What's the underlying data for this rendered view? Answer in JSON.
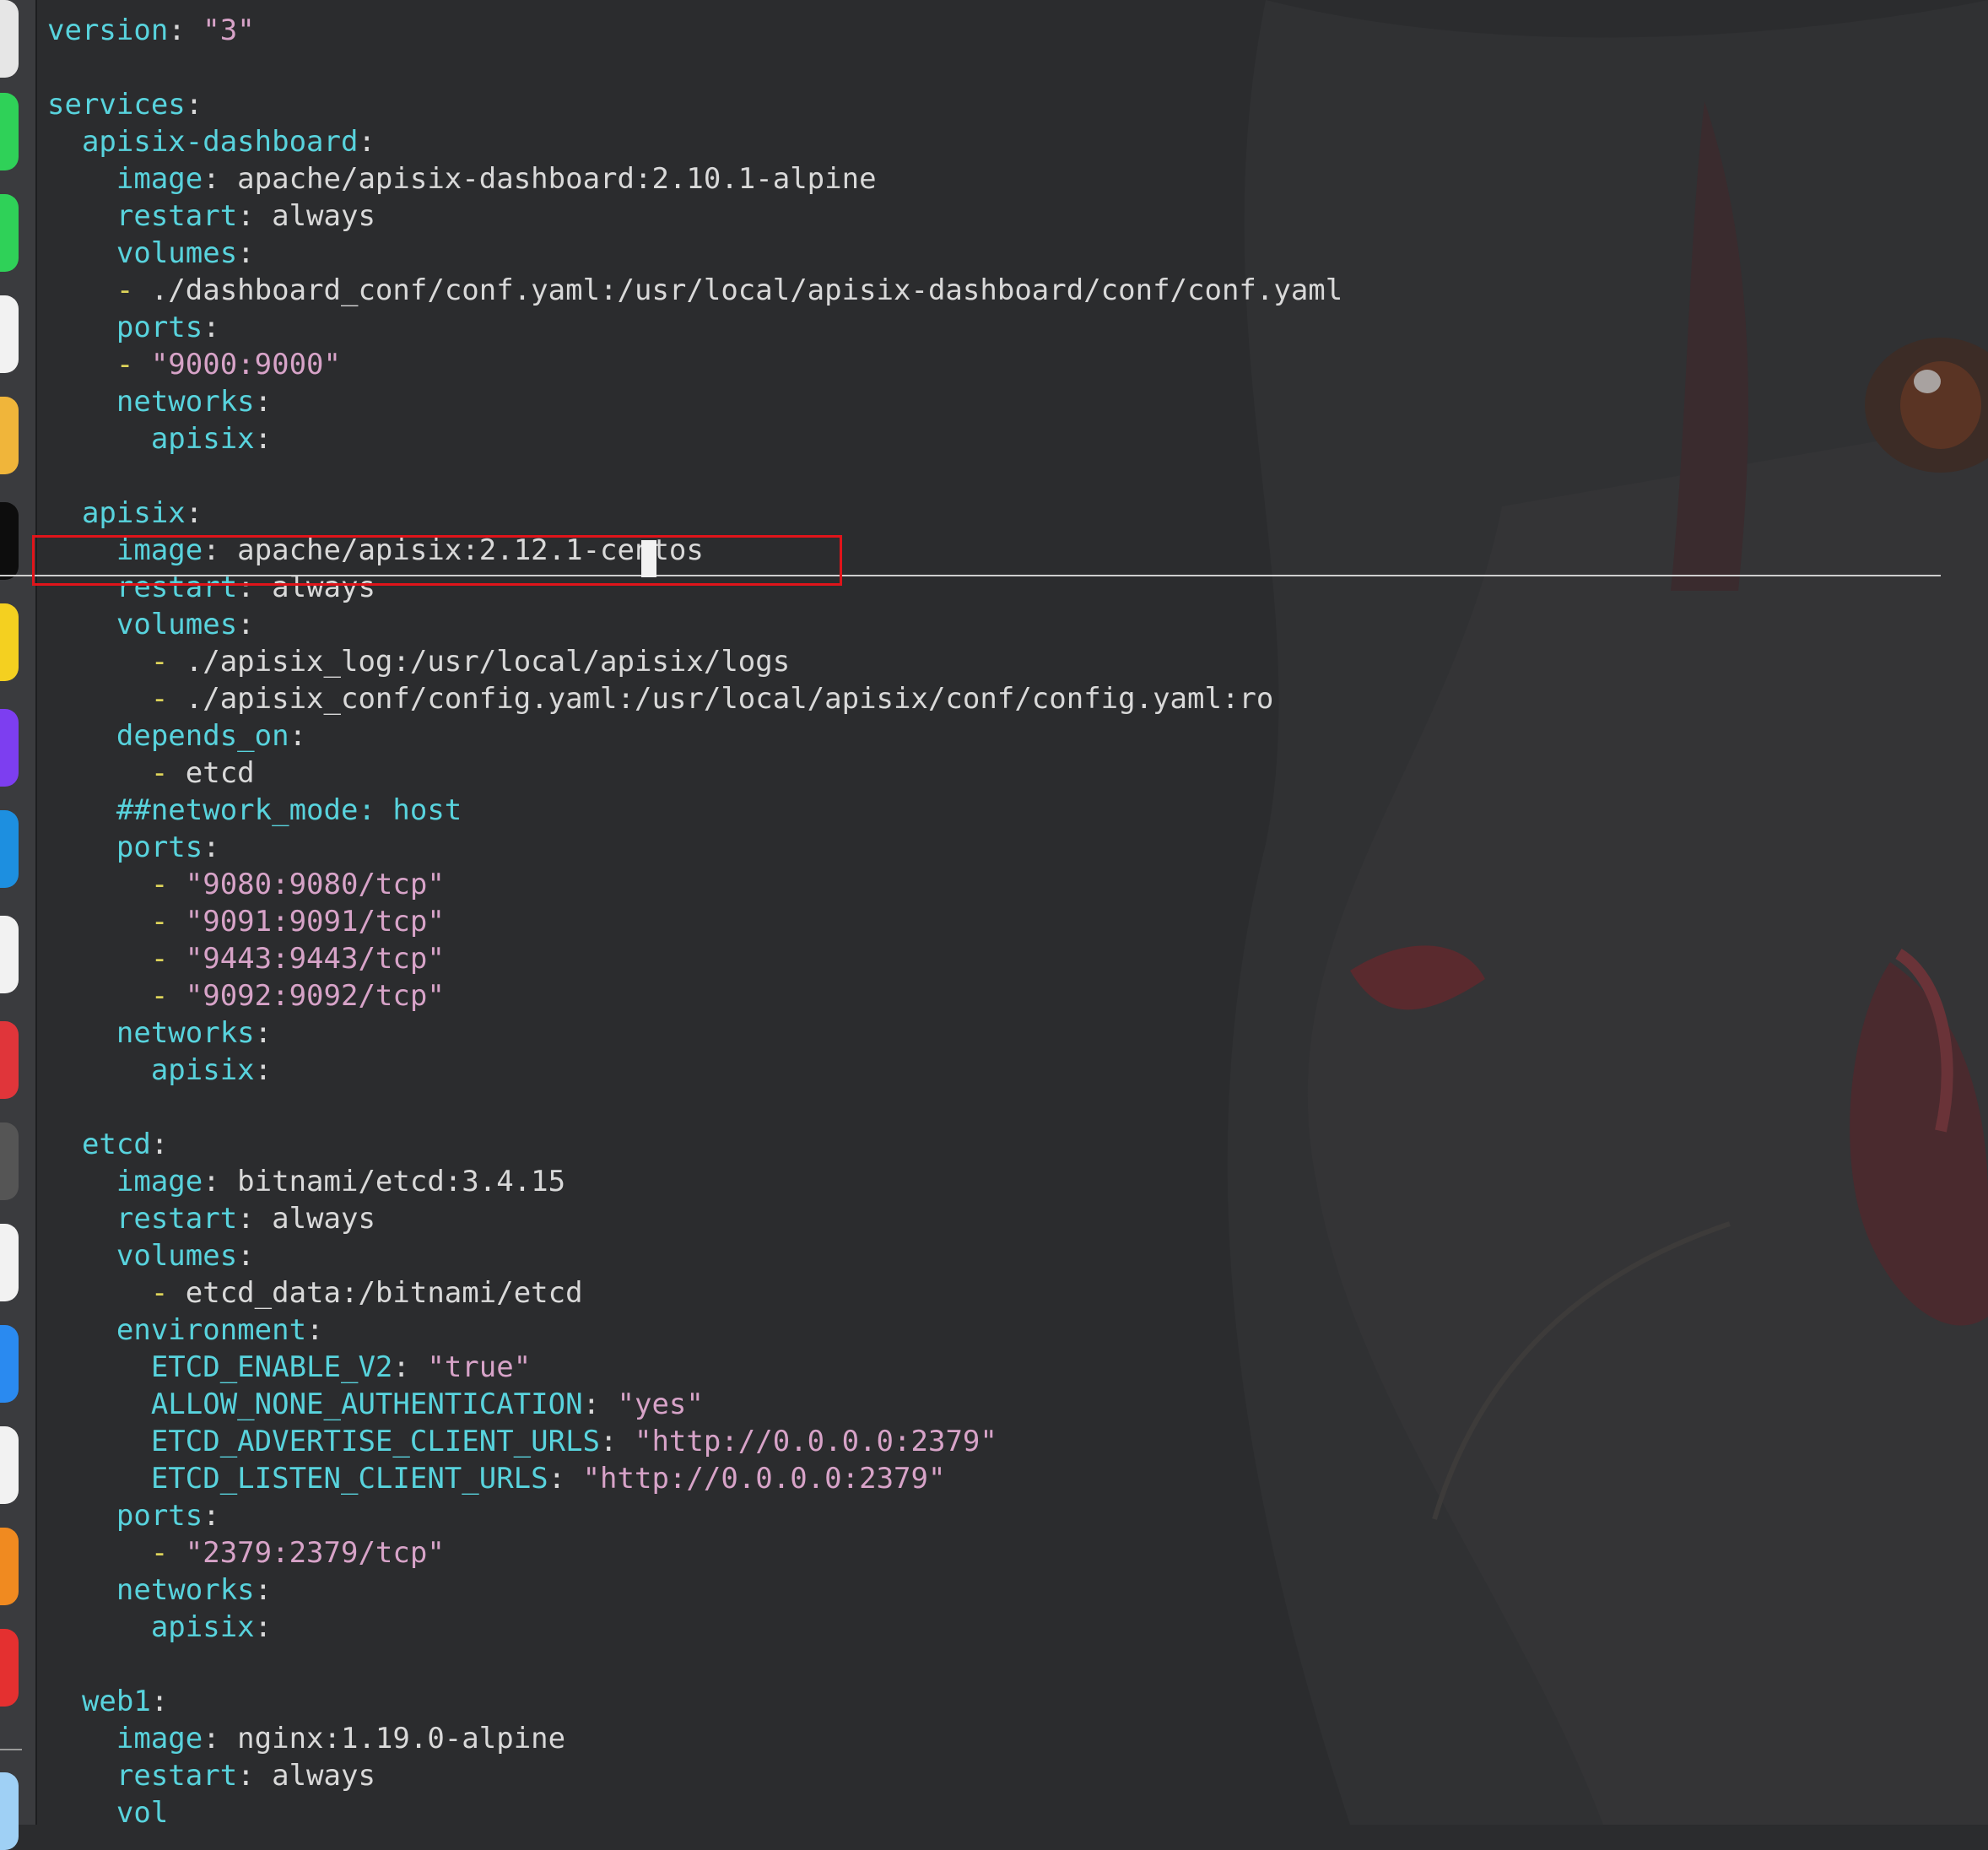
{
  "editor": {
    "lines": [
      [
        {
          "t": "version",
          "c": "k"
        },
        {
          "t": ": ",
          "c": "p"
        },
        {
          "t": "\"3\"",
          "c": "s"
        }
      ],
      [],
      [
        {
          "t": "services",
          "c": "k"
        },
        {
          "t": ":",
          "c": "p"
        }
      ],
      [
        {
          "t": "  apisix-dashboard",
          "c": "k"
        },
        {
          "t": ":",
          "c": "p"
        }
      ],
      [
        {
          "t": "    image",
          "c": "k"
        },
        {
          "t": ": apache/apisix-dashboard:2.10.1-alpine",
          "c": "p"
        }
      ],
      [
        {
          "t": "    restart",
          "c": "k"
        },
        {
          "t": ": always",
          "c": "p"
        }
      ],
      [
        {
          "t": "    volumes",
          "c": "k"
        },
        {
          "t": ":",
          "c": "p"
        }
      ],
      [
        {
          "t": "    - ",
          "c": "d"
        },
        {
          "t": "./dashboard_conf/conf.yaml:/usr/local/apisix-dashboard/conf/conf.yaml",
          "c": "p"
        }
      ],
      [
        {
          "t": "    ports",
          "c": "k"
        },
        {
          "t": ":",
          "c": "p"
        }
      ],
      [
        {
          "t": "    - ",
          "c": "d"
        },
        {
          "t": "\"9000:9000\"",
          "c": "s"
        }
      ],
      [
        {
          "t": "    networks",
          "c": "k"
        },
        {
          "t": ":",
          "c": "p"
        }
      ],
      [
        {
          "t": "      apisix",
          "c": "k"
        },
        {
          "t": ":",
          "c": "p"
        }
      ],
      [],
      [
        {
          "t": "  apisix",
          "c": "k"
        },
        {
          "t": ":",
          "c": "p"
        }
      ],
      [
        {
          "t": "    image",
          "c": "k"
        },
        {
          "t": ": apache/apisix:2.12.1-centos",
          "c": "p"
        }
      ],
      [
        {
          "t": "    restart",
          "c": "k"
        },
        {
          "t": ": always",
          "c": "p"
        }
      ],
      [
        {
          "t": "    volumes",
          "c": "k"
        },
        {
          "t": ":",
          "c": "p"
        }
      ],
      [
        {
          "t": "      - ",
          "c": "d"
        },
        {
          "t": "./apisix_log:/usr/local/apisix/logs",
          "c": "p"
        }
      ],
      [
        {
          "t": "      - ",
          "c": "d"
        },
        {
          "t": "./apisix_conf/config.yaml:/usr/local/apisix/conf/config.yaml:ro",
          "c": "p"
        }
      ],
      [
        {
          "t": "    depends_on",
          "c": "k"
        },
        {
          "t": ":",
          "c": "p"
        }
      ],
      [
        {
          "t": "      - ",
          "c": "d"
        },
        {
          "t": "etcd",
          "c": "p"
        }
      ],
      [
        {
          "t": "    ##network_mode: host",
          "c": "c"
        }
      ],
      [
        {
          "t": "    ports",
          "c": "k"
        },
        {
          "t": ":",
          "c": "p"
        }
      ],
      [
        {
          "t": "      - ",
          "c": "d"
        },
        {
          "t": "\"9080:9080/tcp\"",
          "c": "s"
        }
      ],
      [
        {
          "t": "      - ",
          "c": "d"
        },
        {
          "t": "\"9091:9091/tcp\"",
          "c": "s"
        }
      ],
      [
        {
          "t": "      - ",
          "c": "d"
        },
        {
          "t": "\"9443:9443/tcp\"",
          "c": "s"
        }
      ],
      [
        {
          "t": "      - ",
          "c": "d"
        },
        {
          "t": "\"9092:9092/tcp\"",
          "c": "s"
        }
      ],
      [
        {
          "t": "    networks",
          "c": "k"
        },
        {
          "t": ":",
          "c": "p"
        }
      ],
      [
        {
          "t": "      apisix",
          "c": "k"
        },
        {
          "t": ":",
          "c": "p"
        }
      ],
      [],
      [
        {
          "t": "  etcd",
          "c": "k"
        },
        {
          "t": ":",
          "c": "p"
        }
      ],
      [
        {
          "t": "    image",
          "c": "k"
        },
        {
          "t": ": bitnami/etcd:3.4.15",
          "c": "p"
        }
      ],
      [
        {
          "t": "    restart",
          "c": "k"
        },
        {
          "t": ": always",
          "c": "p"
        }
      ],
      [
        {
          "t": "    volumes",
          "c": "k"
        },
        {
          "t": ":",
          "c": "p"
        }
      ],
      [
        {
          "t": "      - ",
          "c": "d"
        },
        {
          "t": "etcd_data:/bitnami/etcd",
          "c": "p"
        }
      ],
      [
        {
          "t": "    environment",
          "c": "k"
        },
        {
          "t": ":",
          "c": "p"
        }
      ],
      [
        {
          "t": "      ETCD_ENABLE_V2",
          "c": "k"
        },
        {
          "t": ": ",
          "c": "p"
        },
        {
          "t": "\"true\"",
          "c": "s"
        }
      ],
      [
        {
          "t": "      ALLOW_NONE_AUTHENTICATION",
          "c": "k"
        },
        {
          "t": ": ",
          "c": "p"
        },
        {
          "t": "\"yes\"",
          "c": "s"
        }
      ],
      [
        {
          "t": "      ETCD_ADVERTISE_CLIENT_URLS",
          "c": "k"
        },
        {
          "t": ": ",
          "c": "p"
        },
        {
          "t": "\"http://0.0.0.0:2379\"",
          "c": "s"
        }
      ],
      [
        {
          "t": "      ETCD_LISTEN_CLIENT_URLS",
          "c": "k"
        },
        {
          "t": ": ",
          "c": "p"
        },
        {
          "t": "\"http://0.0.0.0:2379\"",
          "c": "s"
        }
      ],
      [
        {
          "t": "    ports",
          "c": "k"
        },
        {
          "t": ":",
          "c": "p"
        }
      ],
      [
        {
          "t": "      - ",
          "c": "d"
        },
        {
          "t": "\"2379:2379/tcp\"",
          "c": "s"
        }
      ],
      [
        {
          "t": "    networks",
          "c": "k"
        },
        {
          "t": ":",
          "c": "p"
        }
      ],
      [
        {
          "t": "      apisix",
          "c": "k"
        },
        {
          "t": ":",
          "c": "p"
        }
      ],
      [],
      [
        {
          "t": "  web1",
          "c": "k"
        },
        {
          "t": ":",
          "c": "p"
        }
      ],
      [
        {
          "t": "    image",
          "c": "k"
        },
        {
          "t": ": nginx:1.19.0-alpine",
          "c": "p"
        }
      ],
      [
        {
          "t": "    restart",
          "c": "k"
        },
        {
          "t": ": always",
          "c": "p"
        }
      ],
      [
        {
          "t": "    vol",
          "c": "k"
        }
      ]
    ]
  },
  "dock": {
    "apps": [
      {
        "icon": "launchpad-icon",
        "color": "#e6e6e6"
      },
      {
        "icon": "messages-icon",
        "color": "#2fd158"
      },
      {
        "icon": "facetime-icon",
        "color": "#2fd158"
      },
      {
        "icon": "maps-icon",
        "color": "#f2f2f2"
      },
      {
        "icon": "chrome-icon",
        "color": "#f0b53a"
      },
      {
        "icon": "terminal-icon",
        "color": "#0d0d0d"
      },
      {
        "icon": "sketch-icon",
        "color": "#f4d020"
      },
      {
        "icon": "jetbrains-icon",
        "color": "#7d3ef0"
      },
      {
        "icon": "webstorm-icon",
        "color": "#1d8fe0"
      },
      {
        "icon": "browser-icon",
        "color": "#f2f2f2"
      },
      {
        "icon": "app-red-icon",
        "color": "#e0353a"
      },
      {
        "icon": "app-gray-icon",
        "color": "#555555"
      },
      {
        "icon": "acrobat-icon",
        "color": "#f2f2f2"
      },
      {
        "icon": "safari-icon",
        "color": "#2a8af0"
      },
      {
        "icon": "office-icon",
        "color": "#f2f2f2"
      },
      {
        "icon": "app-orange-icon",
        "color": "#f08a20"
      },
      {
        "icon": "pdf-icon",
        "color": "#e43030"
      },
      {
        "icon": "finder-icon",
        "color": "#9fd0f5"
      }
    ]
  }
}
